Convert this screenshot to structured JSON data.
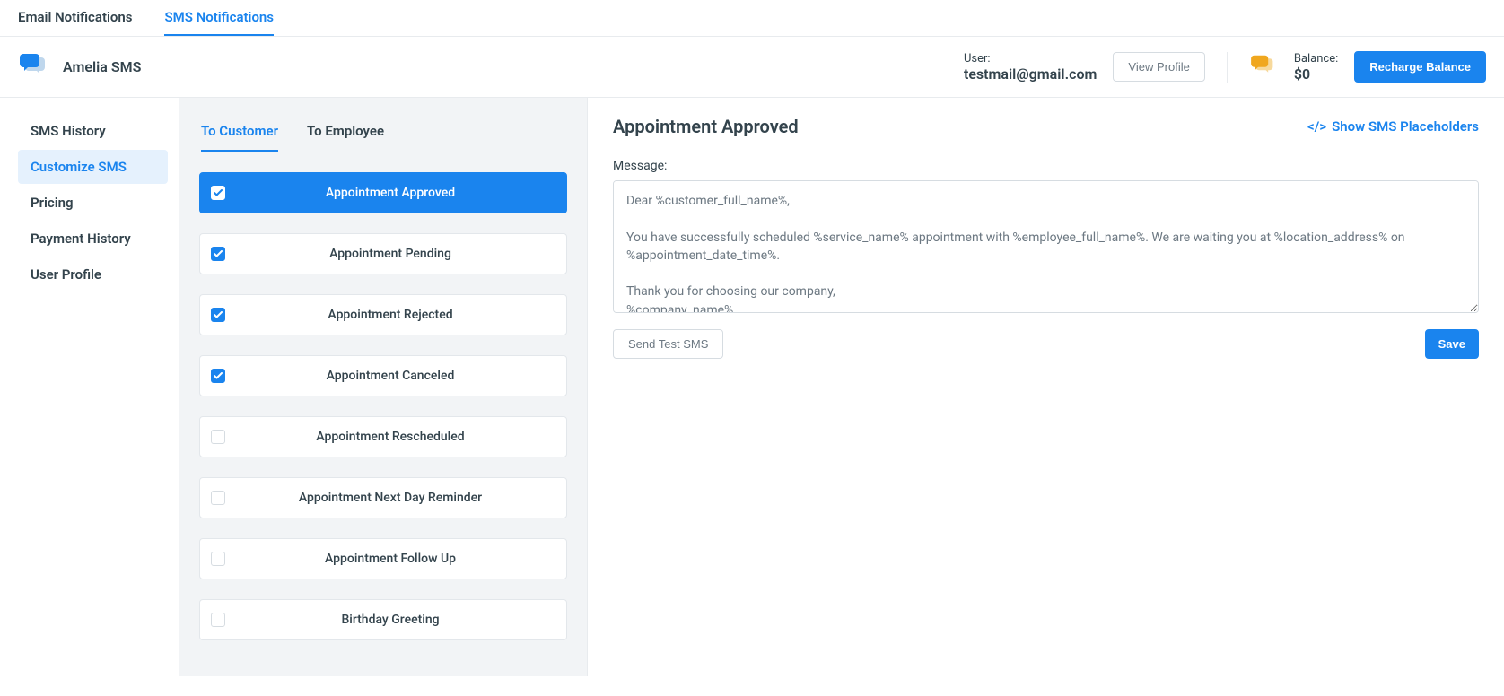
{
  "topTabs": {
    "email": "Email Notifications",
    "sms": "SMS Notifications"
  },
  "header": {
    "brandTitle": "Amelia SMS",
    "userLabel": "User:",
    "userValue": "testmail@gmail.com",
    "viewProfile": "View Profile",
    "balanceLabel": "Balance:",
    "balanceValue": "$0",
    "rechargeBalance": "Recharge Balance"
  },
  "sidebar": {
    "items": [
      {
        "label": "SMS History",
        "active": false
      },
      {
        "label": "Customize SMS",
        "active": true
      },
      {
        "label": "Pricing",
        "active": false
      },
      {
        "label": "Payment History",
        "active": false
      },
      {
        "label": "User Profile",
        "active": false
      }
    ]
  },
  "subTabs": {
    "toCustomer": "To Customer",
    "toEmployee": "To Employee"
  },
  "notifications": [
    {
      "label": "Appointment Approved",
      "checked": true,
      "active": true
    },
    {
      "label": "Appointment Pending",
      "checked": true,
      "active": false
    },
    {
      "label": "Appointment Rejected",
      "checked": true,
      "active": false
    },
    {
      "label": "Appointment Canceled",
      "checked": true,
      "active": false
    },
    {
      "label": "Appointment Rescheduled",
      "checked": false,
      "active": false
    },
    {
      "label": "Appointment Next Day Reminder",
      "checked": false,
      "active": false
    },
    {
      "label": "Appointment Follow Up",
      "checked": false,
      "active": false
    },
    {
      "label": "Birthday Greeting",
      "checked": false,
      "active": false
    }
  ],
  "editor": {
    "title": "Appointment Approved",
    "placeholdersLink": "Show SMS Placeholders",
    "placeholdersCode": "</>",
    "messageLabel": "Message:",
    "messageValue": "Dear %customer_full_name%,\n\nYou have successfully scheduled %service_name% appointment with %employee_full_name%. We are waiting you at %location_address% on %appointment_date_time%.\n\nThank you for choosing our company,\n%company_name%",
    "sendTest": "Send Test SMS",
    "save": "Save"
  }
}
